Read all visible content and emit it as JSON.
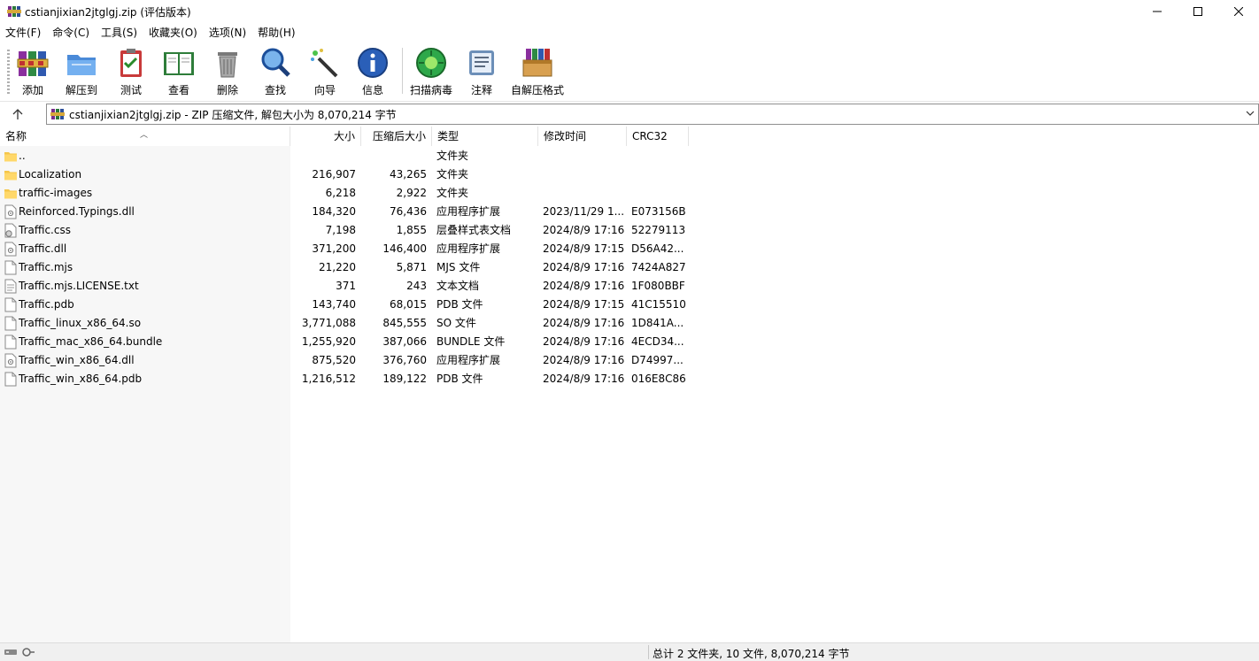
{
  "window": {
    "title": "cstianjixian2jtglgj.zip (评估版本)"
  },
  "menu": [
    "文件(F)",
    "命令(C)",
    "工具(S)",
    "收藏夹(O)",
    "选项(N)",
    "帮助(H)"
  ],
  "toolbar": [
    {
      "label": "添加",
      "icon": "add-books-icon"
    },
    {
      "label": "解压到",
      "icon": "extract-folder-icon"
    },
    {
      "label": "测试",
      "icon": "test-clipboard-icon"
    },
    {
      "label": "查看",
      "icon": "view-book-icon"
    },
    {
      "label": "删除",
      "icon": "trash-icon"
    },
    {
      "label": "查找",
      "icon": "magnifier-icon"
    },
    {
      "label": "向导",
      "icon": "wizard-wand-icon"
    },
    {
      "label": "信息",
      "icon": "info-icon"
    },
    {
      "label": "扫描病毒",
      "icon": "virus-scan-icon"
    },
    {
      "label": "注释",
      "icon": "comment-note-icon"
    },
    {
      "label": "自解压格式",
      "icon": "sfx-box-icon"
    }
  ],
  "address": {
    "text": "cstianjixian2jtglgj.zip - ZIP 压缩文件, 解包大小为 8,070,214 字节"
  },
  "columns": {
    "name": "名称",
    "size": "大小",
    "packed": "压缩后大小",
    "type": "类型",
    "modified": "修改时间",
    "crc": "CRC32"
  },
  "files": [
    {
      "name": "..",
      "size": "",
      "packed": "",
      "type": "文件夹",
      "modified": "",
      "crc": "",
      "icon": "folder"
    },
    {
      "name": "Localization",
      "size": "216,907",
      "packed": "43,265",
      "type": "文件夹",
      "modified": "",
      "crc": "",
      "icon": "folder"
    },
    {
      "name": "traffic-images",
      "size": "6,218",
      "packed": "2,922",
      "type": "文件夹",
      "modified": "",
      "crc": "",
      "icon": "folder"
    },
    {
      "name": "Reinforced.Typings.dll",
      "size": "184,320",
      "packed": "76,436",
      "type": "应用程序扩展",
      "modified": "2023/11/29 1...",
      "crc": "E073156B",
      "icon": "dll"
    },
    {
      "name": "Traffic.css",
      "size": "7,198",
      "packed": "1,855",
      "type": "层叠样式表文档",
      "modified": "2024/8/9 17:16",
      "crc": "52279113",
      "icon": "css"
    },
    {
      "name": "Traffic.dll",
      "size": "371,200",
      "packed": "146,400",
      "type": "应用程序扩展",
      "modified": "2024/8/9 17:15",
      "crc": "D56A42...",
      "icon": "dll"
    },
    {
      "name": "Traffic.mjs",
      "size": "21,220",
      "packed": "5,871",
      "type": "MJS 文件",
      "modified": "2024/8/9 17:16",
      "crc": "7424A827",
      "icon": "file"
    },
    {
      "name": "Traffic.mjs.LICENSE.txt",
      "size": "371",
      "packed": "243",
      "type": "文本文档",
      "modified": "2024/8/9 17:16",
      "crc": "1F080BBF",
      "icon": "txt"
    },
    {
      "name": "Traffic.pdb",
      "size": "143,740",
      "packed": "68,015",
      "type": "PDB 文件",
      "modified": "2024/8/9 17:15",
      "crc": "41C15510",
      "icon": "file"
    },
    {
      "name": "Traffic_linux_x86_64.so",
      "size": "3,771,088",
      "packed": "845,555",
      "type": "SO 文件",
      "modified": "2024/8/9 17:16",
      "crc": "1D841A...",
      "icon": "file"
    },
    {
      "name": "Traffic_mac_x86_64.bundle",
      "size": "1,255,920",
      "packed": "387,066",
      "type": "BUNDLE 文件",
      "modified": "2024/8/9 17:16",
      "crc": "4ECD34...",
      "icon": "file"
    },
    {
      "name": "Traffic_win_x86_64.dll",
      "size": "875,520",
      "packed": "376,760",
      "type": "应用程序扩展",
      "modified": "2024/8/9 17:16",
      "crc": "D74997...",
      "icon": "dll"
    },
    {
      "name": "Traffic_win_x86_64.pdb",
      "size": "1,216,512",
      "packed": "189,122",
      "type": "PDB 文件",
      "modified": "2024/8/9 17:16",
      "crc": "016E8C86",
      "icon": "file"
    }
  ],
  "status": {
    "text": "总计 2 文件夹, 10 文件, 8,070,214 字节"
  }
}
